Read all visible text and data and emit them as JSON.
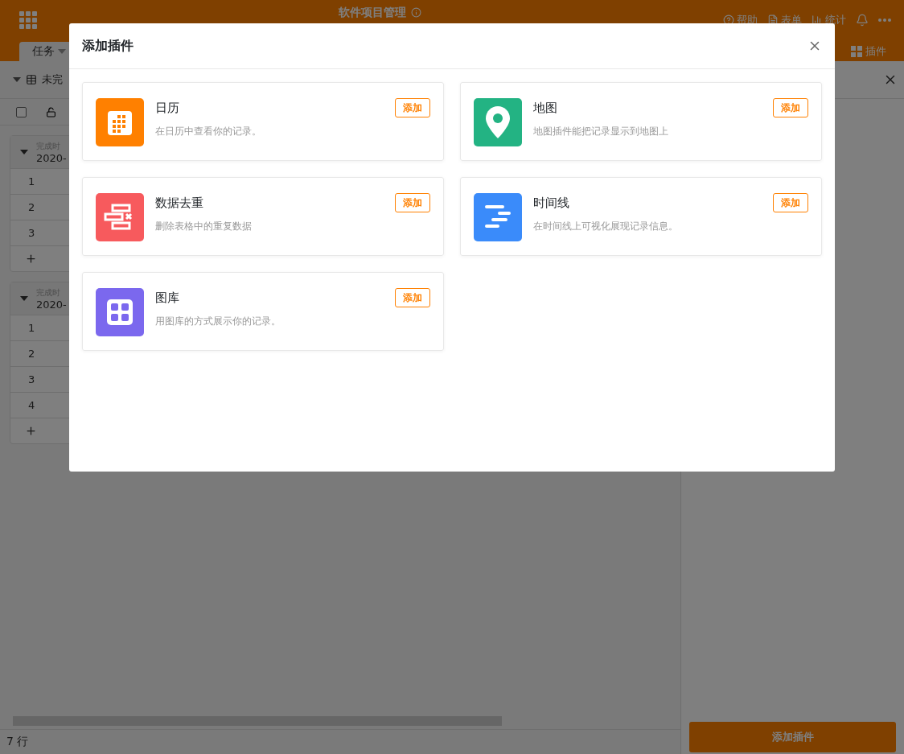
{
  "app": {
    "title": "软件项目管理",
    "header_actions": [
      {
        "kind": "help",
        "label": "帮助"
      },
      {
        "kind": "form",
        "label": "表单"
      },
      {
        "kind": "stats",
        "label": "统计"
      },
      {
        "kind": "bell"
      },
      {
        "kind": "more"
      }
    ],
    "tabs": [
      {
        "label": "任务",
        "selected": true
      }
    ],
    "plugins_button": "插件",
    "view": {
      "name": "未完"
    },
    "select_all": {
      "checked": false
    },
    "groups": [
      {
        "label": "完成时",
        "value": "2020-",
        "rows": [
          "1",
          "2",
          "3"
        ]
      },
      {
        "label": "完成时",
        "value": "2020-",
        "rows": [
          "1",
          "2",
          "3",
          "4"
        ]
      }
    ],
    "footer": "7 行"
  },
  "side_panel": {
    "button": "添加插件"
  },
  "dialog": {
    "title": "添加插件",
    "plugins": [
      {
        "kind": "calendar",
        "color": "#ff8000",
        "name": "日历",
        "description": "在日历中查看你的记录。",
        "button": "添加"
      },
      {
        "kind": "map",
        "color": "#23b383",
        "name": "地图",
        "description": "地图插件能把记录显示到地图上",
        "button": "添加"
      },
      {
        "kind": "dedupe",
        "color": "#f75a5d",
        "name": "数据去重",
        "description": "删除表格中的重复数据",
        "button": "添加"
      },
      {
        "kind": "timeline",
        "color": "#3a8bfa",
        "name": "时间线",
        "description": "在时间线上可视化展现记录信息。",
        "button": "添加"
      },
      {
        "kind": "gallery",
        "color": "#7b68ee",
        "name": "图库",
        "description": "用图库的方式展示你的记录。",
        "button": "添加"
      }
    ]
  }
}
